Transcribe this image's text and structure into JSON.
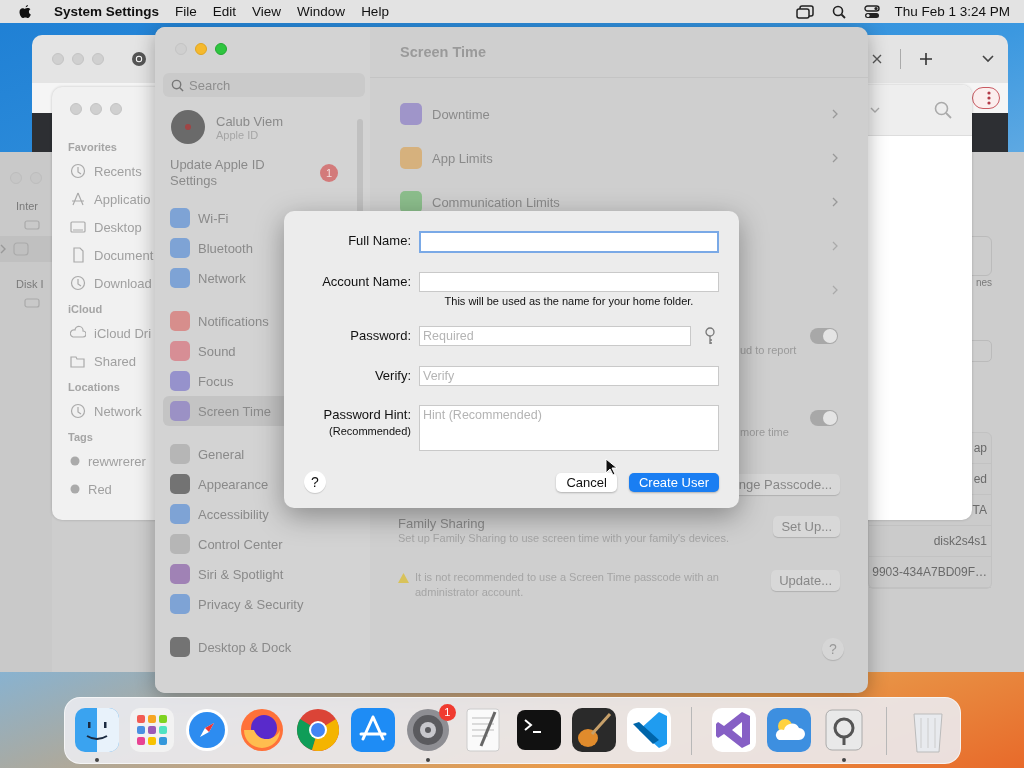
{
  "menubar": {
    "app_name": "System Settings",
    "menus": [
      "File",
      "Edit",
      "View",
      "Window",
      "Help"
    ],
    "clock": "Thu Feb 1  3:24 PM"
  },
  "disk_utility": {
    "sidebar": [
      "Inter",
      "Disk I"
    ],
    "caption": "nes",
    "details": [
      "ap",
      "ed",
      "TA",
      "disk2s4s1",
      "9903-434A7BD09F…"
    ]
  },
  "finder": {
    "sections": [
      {
        "title": "Favorites",
        "items": [
          "Recents",
          "Applicatio",
          "Desktop",
          "Document",
          "Download"
        ]
      },
      {
        "title": "iCloud",
        "items": [
          "iCloud Dri",
          "Shared"
        ]
      },
      {
        "title": "Locations",
        "items": [
          "Network"
        ]
      },
      {
        "title": "Tags",
        "items": [
          "rewwrerer",
          "Red"
        ]
      }
    ]
  },
  "settings": {
    "title": "Screen Time",
    "search_placeholder": "Search",
    "account": {
      "name": "Calub Viem",
      "subtitle": "Apple ID"
    },
    "update_notice": {
      "text": "Update Apple ID Settings",
      "badge": "1"
    },
    "sidebar_groups": [
      [
        {
          "label": "Wi-Fi",
          "selected": false
        },
        {
          "label": "Bluetooth",
          "selected": false
        },
        {
          "label": "Network",
          "selected": false
        }
      ],
      [
        {
          "label": "Notifications",
          "selected": false
        },
        {
          "label": "Sound",
          "selected": false
        },
        {
          "label": "Focus",
          "selected": false
        },
        {
          "label": "Screen Time",
          "selected": true
        }
      ],
      [
        {
          "label": "General",
          "selected": false
        },
        {
          "label": "Appearance",
          "selected": false
        },
        {
          "label": "Accessibility",
          "selected": false
        },
        {
          "label": "Control Center",
          "selected": false
        },
        {
          "label": "Siri & Spotlight",
          "selected": false
        },
        {
          "label": "Privacy & Security",
          "selected": false
        }
      ],
      [
        {
          "label": "Desktop & Dock",
          "selected": false
        }
      ]
    ],
    "rows": [
      {
        "label": "Downtime"
      },
      {
        "label": "App Limits"
      },
      {
        "label": "Communication Limits"
      }
    ],
    "toggles": [
      {
        "text": "ud to report",
        "on": true
      },
      {
        "text": "more time",
        "on": true
      }
    ],
    "passcode_button": "nge Passcode...",
    "family_sharing": {
      "title": "Family Sharing",
      "description": "Set up Family Sharing to use screen time with your family's devices.",
      "button": "Set Up..."
    },
    "warning": {
      "text": "It is not recommended to use a Screen Time passcode with an administrator account.",
      "button": "Update..."
    },
    "help": "?"
  },
  "dialog": {
    "fields": [
      {
        "kind": "text",
        "label": "Full Name:",
        "focused": true
      },
      {
        "kind": "text",
        "label": "Account Name:",
        "focused": false,
        "note": "This will be used as the name for your home folder."
      },
      {
        "kind": "password",
        "label": "Password:",
        "placeholder": "Required",
        "focused": false
      },
      {
        "kind": "text",
        "label": "Verify:",
        "placeholder": "Verify",
        "focused": false
      },
      {
        "kind": "textarea",
        "label": "Password Hint:",
        "sublabel": "(Recommended)",
        "placeholder": "Hint (Recommended)",
        "focused": false
      }
    ],
    "help": "?",
    "buttons": [
      {
        "kind": "secondary",
        "label": "Cancel"
      },
      {
        "kind": "primary",
        "label": "Create User"
      }
    ]
  },
  "dock": {
    "apps": [
      {
        "running": true
      },
      {
        "running": false
      },
      {
        "running": false
      },
      {
        "running": false
      },
      {
        "running": false
      },
      {
        "running": false
      },
      {
        "running": true,
        "badge": "1"
      },
      {
        "running": false
      },
      {
        "running": false
      },
      {
        "running": false
      },
      {
        "running": false
      },
      {
        "running": false
      },
      {
        "running": false
      },
      {
        "running": true
      },
      {
        "running": false
      }
    ]
  }
}
